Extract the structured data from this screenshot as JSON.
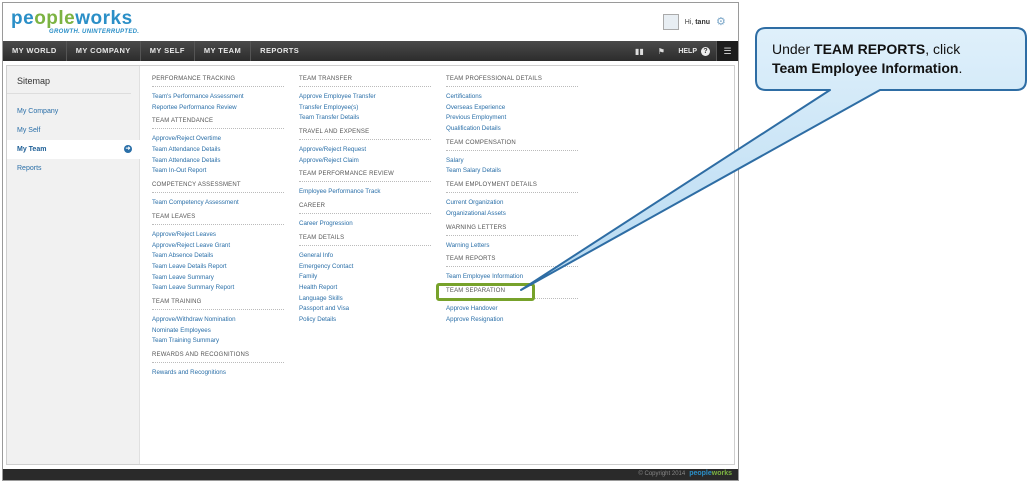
{
  "header": {
    "logo_name_part1": "pe",
    "logo_name_part2": "ople",
    "logo_name_part3": "works",
    "logo_tagline": "GROWTH. UNINTERRUPTED.",
    "greeting_prefix": "Hi, ",
    "user_name": "tanu",
    "settings_icon": "gear-icon"
  },
  "nav": {
    "items": [
      "MY WORLD",
      "MY COMPANY",
      "MY SELF",
      "MY TEAM",
      "REPORTS"
    ],
    "help_label": "HELP",
    "icons": [
      "book-icon",
      "flag-icon",
      "help-icon",
      "menu-icon"
    ]
  },
  "sidebar": {
    "title": "Sitemap",
    "items": [
      "My Company",
      "My Self",
      "My Team",
      "Reports"
    ],
    "active": "My Team"
  },
  "columns": [
    {
      "sections": [
        {
          "title": "PERFORMANCE TRACKING",
          "links": [
            "Team's Performance Assessment",
            "Reportee Performance Review"
          ]
        },
        {
          "title": "TEAM ATTENDANCE",
          "links": [
            "Approve/Reject Overtime",
            "Team Attendance Details",
            "Team Attendance Details",
            "Team In-Out Report"
          ]
        },
        {
          "title": "COMPETENCY ASSESSMENT",
          "links": [
            "Team Competency Assessment"
          ]
        },
        {
          "title": "TEAM LEAVES",
          "links": [
            "Approve/Reject Leaves",
            "Approve/Reject Leave Grant",
            "Team Absence Details",
            "Team Leave Details Report",
            "Team Leave Summary",
            "Team Leave Summary Report"
          ]
        },
        {
          "title": "TEAM TRAINING",
          "links": [
            "Approve/Withdraw Nomination",
            "Nominate Employees",
            "Team Training Summary"
          ]
        },
        {
          "title": "REWARDS AND RECOGNITIONS",
          "links": [
            "Rewards and Recognitions"
          ]
        }
      ]
    },
    {
      "sections": [
        {
          "title": "TEAM TRANSFER",
          "links": [
            "Approve Employee Transfer",
            "Transfer Employee(s)",
            "Team Transfer Details"
          ]
        },
        {
          "title": "TRAVEL AND EXPENSE",
          "links": [
            "Approve/Reject Request",
            "Approve/Reject Claim"
          ]
        },
        {
          "title": "TEAM PERFORMANCE REVIEW",
          "links": [
            "Employee Performance Track"
          ]
        },
        {
          "title": "CAREER",
          "links": [
            "Career Progression"
          ]
        },
        {
          "title": "TEAM DETAILS",
          "links": [
            "General Info",
            "Emergency Contact",
            "Family",
            "Health Report",
            "Language Skills",
            "Passport and Visa",
            "Policy Details"
          ]
        }
      ]
    },
    {
      "sections": [
        {
          "title": "TEAM PROFESSIONAL DETAILS",
          "links": [
            "Certifications",
            "Overseas Experience",
            "Previous Employment",
            "Qualification Details"
          ]
        },
        {
          "title": "TEAM COMPENSATION",
          "links": [
            "Salary",
            "Team Salary Details"
          ]
        },
        {
          "title": "TEAM EMPLOYMENT DETAILS",
          "links": [
            "Current Organization",
            "Organizational Assets"
          ]
        },
        {
          "title": "WARNING LETTERS",
          "links": [
            "Warning Letters"
          ]
        },
        {
          "title": "TEAM REPORTS",
          "links": [
            "Team Employee Information"
          ]
        },
        {
          "title": "TEAM SEPARATION",
          "links": [
            "Approve Handover",
            "Approve Resignation"
          ]
        }
      ]
    }
  ],
  "footer": {
    "copyright": "© Copyright 2014",
    "brand_part1": "people",
    "brand_part2": "works"
  },
  "callout": {
    "line1_prefix": "Under ",
    "line1_bold": "TEAM REPORTS",
    "line1_suffix": ", click",
    "line2_bold": "Team Employee Information",
    "line2_suffix": ".",
    "fill_color": "#c9e4f7",
    "border_color": "#2e6da4",
    "highlight_color": "#77a22b"
  }
}
